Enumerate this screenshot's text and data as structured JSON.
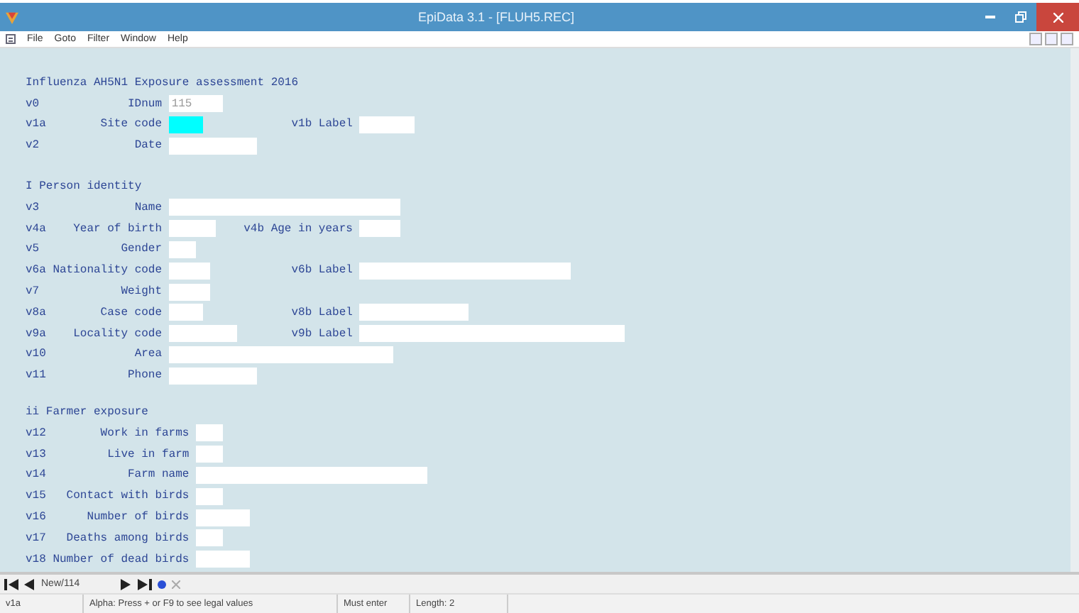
{
  "window": {
    "title": "EpiData 3.1 - [FLUH5.REC]"
  },
  "menu": [
    "File",
    "Goto",
    "Filter",
    "Window",
    "Help"
  ],
  "form": {
    "title": "Influenza AH5N1 Exposure assessment 2016",
    "header_fields": [
      {
        "var": "v0",
        "label": "IDnum",
        "value": "115",
        "focused": false
      },
      {
        "var": "v1a",
        "label": "Site code",
        "focused": true,
        "second": {
          "label": "v1b Label"
        }
      },
      {
        "var": "v2",
        "label": "Date",
        "focused": false
      }
    ],
    "sections": [
      {
        "title": "I Person identity",
        "fields": [
          {
            "var": "v3",
            "label": "Name",
            "focused": false
          },
          {
            "var": "v4a",
            "label": "Year of birth",
            "focused": false,
            "second": {
              "label": "v4b Age in years"
            }
          },
          {
            "var": "v5",
            "label": "Gender",
            "focused": false
          },
          {
            "var": "v6a",
            "label": "Nationality code",
            "focused": false,
            "second": {
              "label": "v6b Label"
            }
          },
          {
            "var": "v7",
            "label": "Weight",
            "focused": false
          },
          {
            "var": "v8a",
            "label": "Case code",
            "focused": false,
            "second": {
              "label": "v8b Label"
            }
          },
          {
            "var": "v9a",
            "label": "Locality code",
            "focused": false,
            "second": {
              "label": "v9b Label"
            }
          },
          {
            "var": "v10",
            "label": "Area",
            "focused": false
          },
          {
            "var": "v11",
            "label": "Phone",
            "focused": false
          }
        ]
      },
      {
        "title": "ii Farmer exposure",
        "fields": [
          {
            "var": "v12",
            "label": "Work in farms",
            "focused": false
          },
          {
            "var": "v13",
            "label": "Live in farm",
            "focused": false
          },
          {
            "var": "v14",
            "label": "Farm name",
            "focused": false
          },
          {
            "var": "v15",
            "label": "Contact with birds",
            "focused": false
          },
          {
            "var": "v16",
            "label": "Number of birds",
            "focused": false
          },
          {
            "var": "v17",
            "label": "Deaths among birds",
            "focused": false
          },
          {
            "var": "v18",
            "label": "Number of dead birds",
            "focused": false
          }
        ]
      }
    ]
  },
  "record_nav": {
    "record": "New/114"
  },
  "status_bar": [
    "v1a",
    "Alpha: Press + or F9 to see legal values",
    "Must enter",
    "Length: 2"
  ]
}
